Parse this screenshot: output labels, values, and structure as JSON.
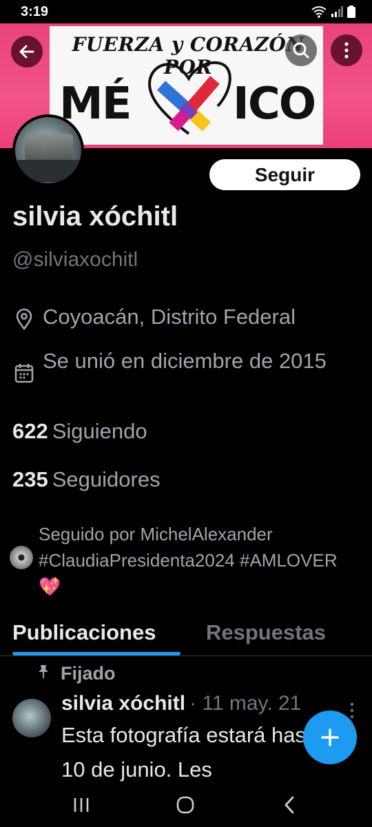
{
  "status_bar": {
    "time": "3:19"
  },
  "banner": {
    "top_text": "FUERZA y CORAZÓN POR",
    "main_left": "MÉ",
    "main_right": "ICO",
    "colors": {
      "background": "#ee4a80",
      "cross_blue": "#2f74d9",
      "cross_red": "#e0283a",
      "cross_yellow": "#f7c41a",
      "cross_magenta": "#d81b8c"
    }
  },
  "header": {
    "back_icon": "arrow-left-icon",
    "search_icon": "search-icon",
    "more_icon": "more-vertical-icon"
  },
  "profile": {
    "follow_label": "Seguir",
    "display_name": "silvia xóchitl",
    "handle": "@silviaxochitl",
    "location": "Coyoacán, Distrito Federal",
    "joined": "Se unió en diciembre de 2015",
    "following_count": "622",
    "following_label": "Siguiendo",
    "followers_count": "235",
    "followers_label": "Seguidores",
    "followed_by": "Seguido por MichelAlexander #ClaudiaPresidenta2024 #AMLOVER💖"
  },
  "tabs": [
    {
      "label": "Publicaciones",
      "active": true
    },
    {
      "label": "Respuestas",
      "active": false
    }
  ],
  "post": {
    "pinned_label": "Fijado",
    "author": "silvia xóchitl",
    "date": "· 11 may. 21",
    "text": "Esta fotografía estará hasta el 10 de junio. Les"
  },
  "colors": {
    "accent": "#1d9bf0",
    "background": "#000000",
    "secondary_text": "#71767b"
  }
}
